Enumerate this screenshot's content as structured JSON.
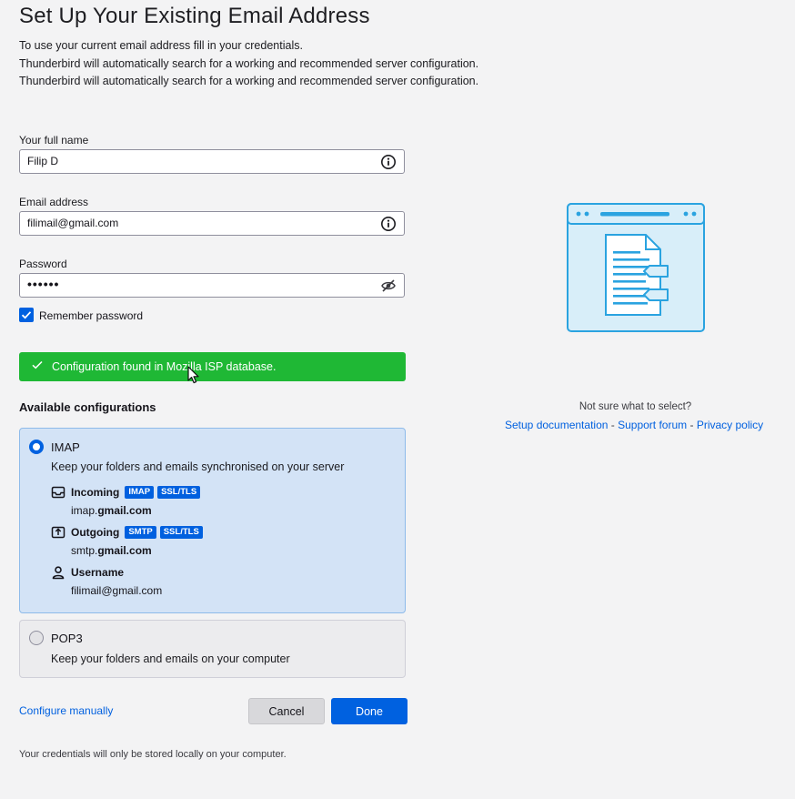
{
  "page": {
    "title": "Set Up Your Existing Email Address",
    "description_lines": [
      "To use your current email address fill in your credentials.",
      "Thunderbird will automatically search for a working and recommended server configuration.",
      "Thunderbird will automatically search for a working and recommended server configuration."
    ]
  },
  "form": {
    "full_name_label": "Your full name",
    "full_name_value": "Filip D",
    "email_label": "Email address",
    "email_value": "filimail@gmail.com",
    "password_label": "Password",
    "password_value": "••••••",
    "remember_label": "Remember password",
    "remember_checked": true
  },
  "notice": {
    "text": "Configuration found in Mozilla ISP database.",
    "color": "#1fb835"
  },
  "configs": {
    "title": "Available configurations",
    "imap": {
      "name": "IMAP",
      "description": "Keep your folders and emails synchronised on your server",
      "selected": true,
      "incoming_label": "Incoming",
      "incoming_badges": [
        "IMAP",
        "SSL/TLS"
      ],
      "incoming_host_prefix": "imap.",
      "incoming_host_domain": "gmail.com",
      "outgoing_label": "Outgoing",
      "outgoing_badges": [
        "SMTP",
        "SSL/TLS"
      ],
      "outgoing_host_prefix": "smtp.",
      "outgoing_host_domain": "gmail.com",
      "username_label": "Username",
      "username_value": "filimail@gmail.com"
    },
    "pop3": {
      "name": "POP3",
      "description": "Keep your folders and emails on your computer",
      "selected": false
    }
  },
  "actions": {
    "configure_manually": "Configure manually",
    "cancel": "Cancel",
    "done": "Done"
  },
  "footer": "Your credentials will only be stored locally on your computer.",
  "help": {
    "prompt": "Not sure what to select?",
    "setup_docs": "Setup documentation",
    "support_forum": "Support forum",
    "privacy_policy": "Privacy policy",
    "separator": " - "
  },
  "colors": {
    "accent": "#0061e0",
    "success": "#1fb835",
    "selected_card": "#d3e3f6",
    "illustration": "#2aa3e0"
  },
  "icons": {
    "name_field": "info-icon",
    "email_field": "info-icon",
    "password_field": "eye-slash-icon",
    "incoming": "inbox-icon",
    "outgoing": "outbox-icon",
    "username": "user-icon",
    "notice": "checkmark-icon",
    "illustration": "document-window-icon"
  }
}
